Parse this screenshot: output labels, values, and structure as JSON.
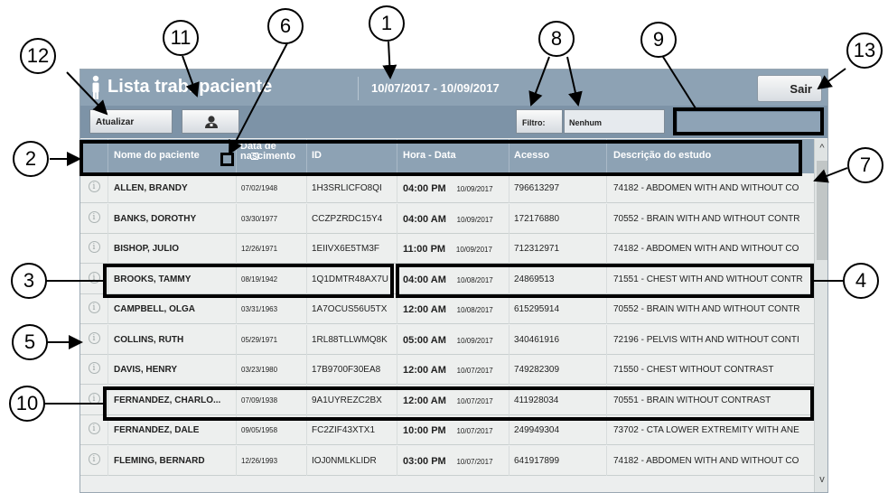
{
  "header": {
    "title": "Lista trab. paciente",
    "date_range": "10/07/2017  -  10/09/2017",
    "exit_label": "Sair"
  },
  "toolbar": {
    "update_label": "Atualizar",
    "filter_label": "Filtro:",
    "filter_value": "Nenhum",
    "search_value": ""
  },
  "columns": {
    "name": "Nome do paciente",
    "dob_line1": "Data de",
    "dob_line2": "nascimento",
    "id": "ID",
    "time_date": "Hora - Data",
    "access": "Acesso",
    "study": "Descrição do estudo"
  },
  "rows": [
    {
      "name": "ALLEN, BRANDY",
      "dob": "07/02/1948",
      "id": "1H3SRLICFO8QI",
      "time": "04:00 PM",
      "date": "10/09/2017",
      "access": "796613297",
      "study": "74182 - ABDOMEN WITH AND WITHOUT CO"
    },
    {
      "name": "BANKS, DOROTHY",
      "dob": "03/30/1977",
      "id": "CCZPZRDC15Y4",
      "time": "04:00 AM",
      "date": "10/09/2017",
      "access": "172176880",
      "study": "70552 - BRAIN WITH AND WITHOUT CONTR"
    },
    {
      "name": "BISHOP, JULIO",
      "dob": "12/26/1971",
      "id": "1EIIVX6E5TM3F",
      "time": "11:00 PM",
      "date": "10/09/2017",
      "access": "712312971",
      "study": "74182 - ABDOMEN WITH AND WITHOUT CO"
    },
    {
      "name": "BROOKS, TAMMY",
      "dob": "08/19/1942",
      "id": "1Q1DMTR48AX7U",
      "time": "04:00 AM",
      "date": "10/08/2017",
      "access": "24869513",
      "study": "71551 - CHEST WITH AND WITHOUT CONTR"
    },
    {
      "name": "CAMPBELL, OLGA",
      "dob": "03/31/1963",
      "id": "1A7OCUS56U5TX",
      "time": "12:00 AM",
      "date": "10/08/2017",
      "access": "615295914",
      "study": "70552 - BRAIN WITH AND WITHOUT CONTR"
    },
    {
      "name": "COLLINS, RUTH",
      "dob": "05/29/1971",
      "id": "1RL88TLLWMQ8K",
      "time": "05:00 AM",
      "date": "10/09/2017",
      "access": "340461916",
      "study": "72196 - PELVIS WITH AND WITHOUT CONTI"
    },
    {
      "name": "DAVIS, HENRY",
      "dob": "03/23/1980",
      "id": "17B9700F30EA8",
      "time": "12:00 AM",
      "date": "10/07/2017",
      "access": "749282309",
      "study": "71550 - CHEST WITHOUT CONTRAST"
    },
    {
      "name": "FERNANDEZ, CHARLO...",
      "dob": "07/09/1938",
      "id": "9A1UYREZC2BX",
      "time": "12:00 AM",
      "date": "10/07/2017",
      "access": "411928034",
      "study": "70551 - BRAIN WITHOUT CONTRAST"
    },
    {
      "name": "FERNANDEZ, DALE",
      "dob": "09/05/1958",
      "id": "FC2ZIF43XTX1",
      "time": "10:00 PM",
      "date": "10/07/2017",
      "access": "249949304",
      "study": "73702 - CTA LOWER EXTREMITY WITH ANE"
    },
    {
      "name": "FLEMING, BERNARD",
      "dob": "12/26/1993",
      "id": "IOJ0NMLKLIDR",
      "time": "03:00 PM",
      "date": "10/07/2017",
      "access": "641917899",
      "study": "74182 - ABDOMEN WITH AND WITHOUT CO"
    }
  ],
  "info_glyph": "i",
  "scroll_up_glyph": "^",
  "scroll_down_glyph": "v",
  "callouts": {
    "c1": "1",
    "c2": "2",
    "c3": "3",
    "c4": "4",
    "c5": "5",
    "c6": "6",
    "c7": "7",
    "c8": "8",
    "c9": "9",
    "c10": "10",
    "c11": "11",
    "c12": "12",
    "c13": "13"
  },
  "icons": {
    "title": "person-icon",
    "patient_button": "patient-icon",
    "row_info": "info-icon",
    "sort": "sort-icon"
  }
}
